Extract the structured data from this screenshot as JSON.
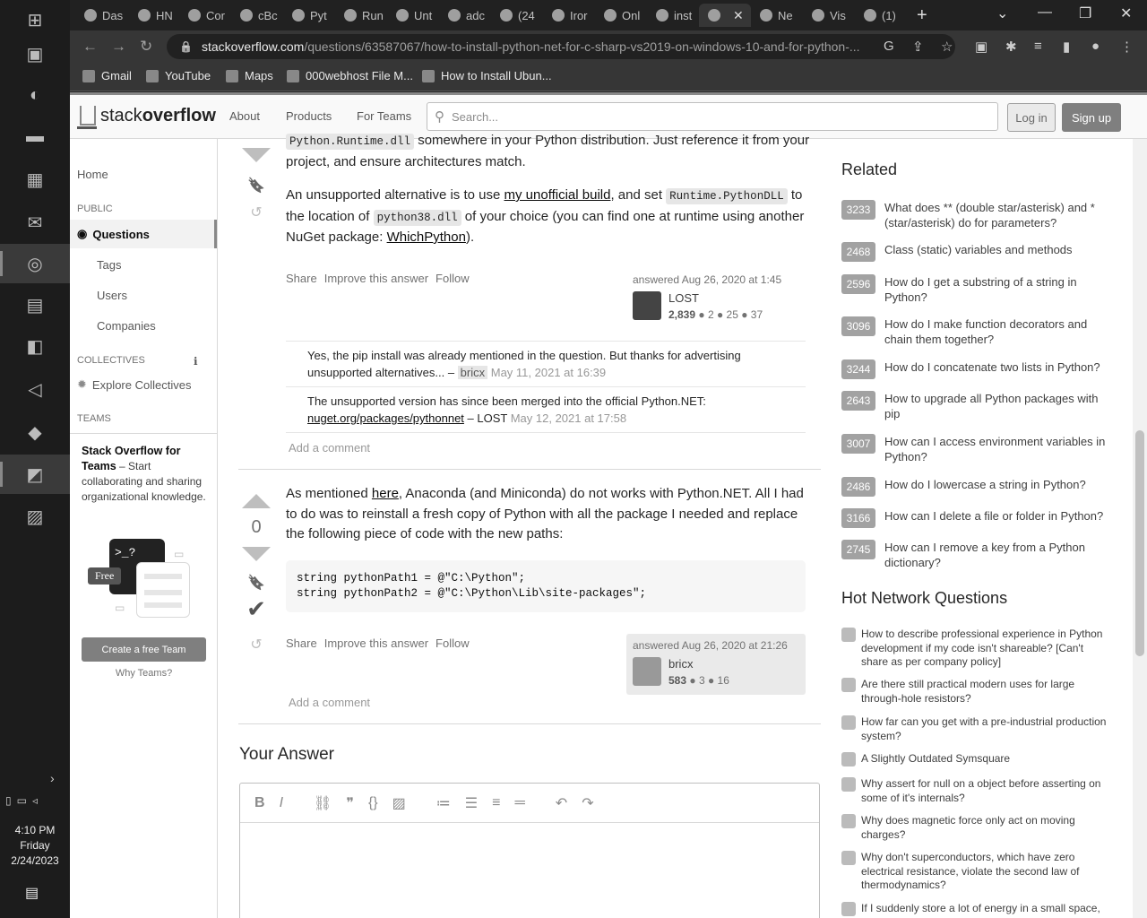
{
  "taskbar": {
    "time": "4:10 PM",
    "day": "Friday",
    "date": "2/24/2023"
  },
  "browser": {
    "tabs": [
      {
        "label": "Das"
      },
      {
        "label": "HN"
      },
      {
        "label": "Cor"
      },
      {
        "label": "cBc"
      },
      {
        "label": "Pyt"
      },
      {
        "label": "Run"
      },
      {
        "label": "Unt"
      },
      {
        "label": "adc"
      },
      {
        "label": "(24"
      },
      {
        "label": "Iror"
      },
      {
        "label": "Onl"
      },
      {
        "label": "inst"
      },
      {
        "label": ""
      },
      {
        "label": "Ne"
      },
      {
        "label": "Vis"
      },
      {
        "label": "(1)"
      }
    ],
    "url_host": "stackoverflow.com",
    "url_path": "/questions/63587067/how-to-install-python-net-for-c-sharp-vs2019-on-windows-10-and-for-python-..."
  },
  "bookmarks": [
    {
      "label": "Gmail"
    },
    {
      "label": "YouTube"
    },
    {
      "label": "Maps"
    },
    {
      "label": "000webhost File M..."
    },
    {
      "label": "How to Install Ubun..."
    }
  ],
  "so_header": {
    "logo_a": "stack",
    "logo_b": "overflow",
    "nav": [
      "About",
      "Products",
      "For Teams"
    ],
    "search_placeholder": "Search...",
    "login": "Log in",
    "signup": "Sign up"
  },
  "leftnav": {
    "home": "Home",
    "public": "PUBLIC",
    "questions": "Questions",
    "tags": "Tags",
    "users": "Users",
    "companies": "Companies",
    "collectives": "COLLECTIVES",
    "explore": "Explore Collectives",
    "teams": "TEAMS",
    "teams_title": "Stack Overflow for Teams",
    "teams_text": " – Start collaborating and sharing organizational knowledge.",
    "art_prompt": ">_?",
    "free": "Free",
    "create_team": "Create a free Team",
    "why_teams": "Why Teams?"
  },
  "answer1": {
    "p1_code": "Python.Runtime.dll",
    "p1_rest": " somewhere in your Python distribution. Just reference it from your project, and ensure architectures match.",
    "p2_a": "An unsupported alternative is to use ",
    "p2_link": "my unofficial build",
    "p2_b": ", and set ",
    "p2_code1": "Runtime.PythonDLL",
    "p2_c": " to the location of ",
    "p2_code2": "python38.dll",
    "p2_d": " of your choice (you can find one at runtime using another NuGet package: ",
    "p2_link2": "WhichPython",
    "p2_e": ").",
    "share": "Share",
    "improve": "Improve this answer",
    "follow": "Follow",
    "answered": "answered Aug 26, 2020 at 1:45",
    "user": "LOST",
    "rep": "2,839",
    "badges": "● 2 ● 25 ● 37",
    "comment1_text": "Yes, the pip install was already mentioned in the question. But thanks for advertising unsupported alternatives... – ",
    "comment1_user": "bricx",
    "comment1_date": " May 11, 2021 at 16:39",
    "comment2_text": "The unsupported version has since been merged into the official Python.NET: ",
    "comment2_link": "nuget.org/packages/pythonnet",
    "comment2_user": " – LOST",
    "comment2_date": " May 12, 2021 at 17:58",
    "add_comment": "Add a comment"
  },
  "answer2": {
    "votes": "0",
    "p1_a": "As mentioned ",
    "p1_link": "here",
    "p1_b": ", Anaconda (and Miniconda) do not works with Python.NET. All I had to do was to reinstall a fresh copy of Python with all the package I needed and replace the following piece of code with the new paths:",
    "code": "string pythonPath1 = @\"C:\\Python\";\nstring pythonPath2 = @\"C:\\Python\\Lib\\site-packages\";",
    "share": "Share",
    "improve": "Improve this answer",
    "follow": "Follow",
    "answered": "answered Aug 26, 2020 at 21:26",
    "user": "bricx",
    "rep": "583",
    "badges": "● 3 ● 16",
    "add_comment": "Add a comment"
  },
  "your_answer": "Your Answer",
  "sidebar": {
    "related_title": "Related",
    "related": [
      {
        "score": "3233",
        "title": "What does ** (double star/asterisk) and * (star/asterisk) do for parameters?"
      },
      {
        "score": "2468",
        "title": "Class (static) variables and methods"
      },
      {
        "score": "2596",
        "title": "How do I get a substring of a string in Python?"
      },
      {
        "score": "3096",
        "title": "How do I make function decorators and chain them together?"
      },
      {
        "score": "3244",
        "title": "How do I concatenate two lists in Python?"
      },
      {
        "score": "2643",
        "title": "How to upgrade all Python packages with pip"
      },
      {
        "score": "3007",
        "title": "How can I access environment variables in Python?"
      },
      {
        "score": "2486",
        "title": "How do I lowercase a string in Python?"
      },
      {
        "score": "3166",
        "title": "How can I delete a file or folder in Python?"
      },
      {
        "score": "2745",
        "title": "How can I remove a key from a Python dictionary?"
      }
    ],
    "hnq_title": "Hot Network Questions",
    "hnq": [
      {
        "title": "How to describe professional experience in Python development if my code isn't shareable? [Can't share as per company policy]"
      },
      {
        "title": "Are there still practical modern uses for large through-hole resistors?"
      },
      {
        "title": "How far can you get with a pre-industrial production system?"
      },
      {
        "title": "A Slightly Outdated Symsquare"
      },
      {
        "title": "Why assert for null on a object before asserting on some of it's internals?"
      },
      {
        "title": "Why does magnetic force only act on moving charges?"
      },
      {
        "title": "Why don't superconductors, which have zero electrical resistance, violate the second law of thermodynamics?"
      },
      {
        "title": "If I suddenly store a lot of energy in a small space,"
      }
    ]
  }
}
